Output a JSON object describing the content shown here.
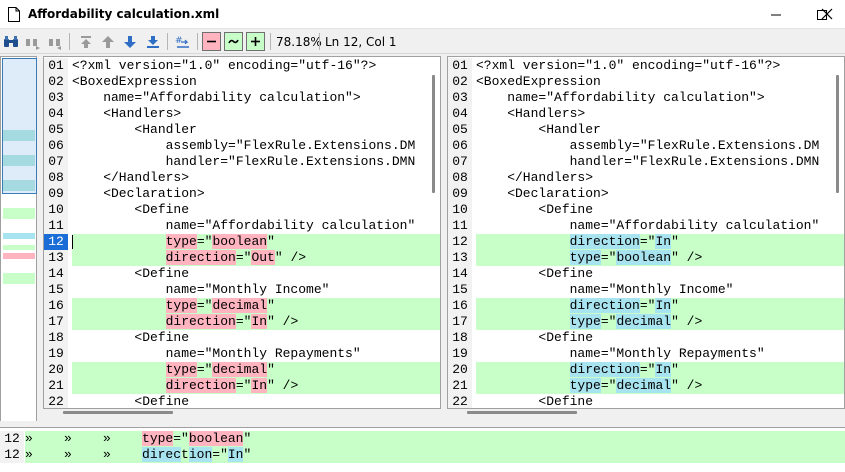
{
  "window": {
    "title": "Affordability calculation.xml"
  },
  "toolbar": {
    "zoom": "78.18%",
    "position": "Ln 12, Col 1"
  },
  "colors": {
    "added": "#c8ffc8",
    "removed": "#ffb4c0",
    "moved": "#a8e4f0",
    "selection": "#1a6dd6"
  },
  "left_pane": {
    "lines": [
      {
        "num": "01",
        "changed": false,
        "parts": [
          {
            "t": "<?xml version=\"1.0\" encoding=\"utf-16\"?>"
          }
        ]
      },
      {
        "num": "02",
        "changed": false,
        "parts": [
          {
            "t": "<BoxedExpression"
          }
        ]
      },
      {
        "num": "03",
        "changed": false,
        "parts": [
          {
            "t": "    name=\"Affordability calculation\">"
          }
        ]
      },
      {
        "num": "04",
        "changed": false,
        "parts": [
          {
            "t": "    <Handlers>"
          }
        ]
      },
      {
        "num": "05",
        "changed": false,
        "parts": [
          {
            "t": "        <Handler"
          }
        ]
      },
      {
        "num": "06",
        "changed": false,
        "parts": [
          {
            "t": "            assembly=\"FlexRule.Extensions.DM"
          }
        ]
      },
      {
        "num": "07",
        "changed": false,
        "parts": [
          {
            "t": "            handler=\"FlexRule.Extensions.DMN"
          }
        ]
      },
      {
        "num": "08",
        "changed": false,
        "parts": [
          {
            "t": "    </Handlers>"
          }
        ]
      },
      {
        "num": "09",
        "changed": false,
        "parts": [
          {
            "t": "    <Declaration>"
          }
        ]
      },
      {
        "num": "10",
        "changed": false,
        "parts": [
          {
            "t": "        <Define"
          }
        ]
      },
      {
        "num": "11",
        "changed": false,
        "parts": [
          {
            "t": "            name=\"Affordability calculation\""
          }
        ]
      },
      {
        "num": "12",
        "changed": true,
        "selected": true,
        "parts": [
          {
            "t": "            "
          },
          {
            "t": "type",
            "h": "red"
          },
          {
            "t": "=\""
          },
          {
            "t": "boolean",
            "h": "red"
          },
          {
            "t": "\""
          }
        ]
      },
      {
        "num": "13",
        "changed": true,
        "parts": [
          {
            "t": "            "
          },
          {
            "t": "direction",
            "h": "red"
          },
          {
            "t": "=\""
          },
          {
            "t": "Out",
            "h": "red"
          },
          {
            "t": "\" />"
          }
        ]
      },
      {
        "num": "14",
        "changed": false,
        "parts": [
          {
            "t": "        <Define"
          }
        ]
      },
      {
        "num": "15",
        "changed": false,
        "parts": [
          {
            "t": "            name=\"Monthly Income\""
          }
        ]
      },
      {
        "num": "16",
        "changed": true,
        "parts": [
          {
            "t": "            "
          },
          {
            "t": "type",
            "h": "red"
          },
          {
            "t": "=\""
          },
          {
            "t": "decimal",
            "h": "red"
          },
          {
            "t": "\""
          }
        ]
      },
      {
        "num": "17",
        "changed": true,
        "parts": [
          {
            "t": "            "
          },
          {
            "t": "direction",
            "h": "red"
          },
          {
            "t": "=\""
          },
          {
            "t": "In",
            "h": "red"
          },
          {
            "t": "\" />"
          }
        ]
      },
      {
        "num": "18",
        "changed": false,
        "parts": [
          {
            "t": "        <Define"
          }
        ]
      },
      {
        "num": "19",
        "changed": false,
        "parts": [
          {
            "t": "            name=\"Monthly Repayments\""
          }
        ]
      },
      {
        "num": "20",
        "changed": true,
        "parts": [
          {
            "t": "            "
          },
          {
            "t": "type",
            "h": "red"
          },
          {
            "t": "=\""
          },
          {
            "t": "decimal",
            "h": "red"
          },
          {
            "t": "\""
          }
        ]
      },
      {
        "num": "21",
        "changed": true,
        "parts": [
          {
            "t": "            "
          },
          {
            "t": "direction",
            "h": "red"
          },
          {
            "t": "=\""
          },
          {
            "t": "In",
            "h": "red"
          },
          {
            "t": "\" />"
          }
        ]
      },
      {
        "num": "22",
        "changed": false,
        "parts": [
          {
            "t": "        <Define"
          }
        ]
      }
    ]
  },
  "right_pane": {
    "lines": [
      {
        "num": "01",
        "changed": false,
        "parts": [
          {
            "t": "<?xml version=\"1.0\" encoding=\"utf-16\"?>"
          }
        ]
      },
      {
        "num": "02",
        "changed": false,
        "parts": [
          {
            "t": "<BoxedExpression"
          }
        ]
      },
      {
        "num": "03",
        "changed": false,
        "parts": [
          {
            "t": "    name=\"Affordability calculation\">"
          }
        ]
      },
      {
        "num": "04",
        "changed": false,
        "parts": [
          {
            "t": "    <Handlers>"
          }
        ]
      },
      {
        "num": "05",
        "changed": false,
        "parts": [
          {
            "t": "        <Handler"
          }
        ]
      },
      {
        "num": "06",
        "changed": false,
        "parts": [
          {
            "t": "            assembly=\"FlexRule.Extensions.DM"
          }
        ]
      },
      {
        "num": "07",
        "changed": false,
        "parts": [
          {
            "t": "            handler=\"FlexRule.Extensions.DMN"
          }
        ]
      },
      {
        "num": "08",
        "changed": false,
        "parts": [
          {
            "t": "    </Handlers>"
          }
        ]
      },
      {
        "num": "09",
        "changed": false,
        "parts": [
          {
            "t": "    <Declaration>"
          }
        ]
      },
      {
        "num": "10",
        "changed": false,
        "parts": [
          {
            "t": "        <Define"
          }
        ]
      },
      {
        "num": "11",
        "changed": false,
        "parts": [
          {
            "t": "            name=\"Affordability calculation\""
          }
        ]
      },
      {
        "num": "12",
        "changed": true,
        "parts": [
          {
            "t": "            "
          },
          {
            "t": "direction",
            "h": "blue"
          },
          {
            "t": "=\""
          },
          {
            "t": "In",
            "h": "blue"
          },
          {
            "t": "\""
          }
        ]
      },
      {
        "num": "13",
        "changed": true,
        "parts": [
          {
            "t": "            "
          },
          {
            "t": "type",
            "h": "blue"
          },
          {
            "t": "=\""
          },
          {
            "t": "boolean",
            "h": "blue"
          },
          {
            "t": "\" />"
          }
        ]
      },
      {
        "num": "14",
        "changed": false,
        "parts": [
          {
            "t": "        <Define"
          }
        ]
      },
      {
        "num": "15",
        "changed": false,
        "parts": [
          {
            "t": "            name=\"Monthly Income\""
          }
        ]
      },
      {
        "num": "16",
        "changed": true,
        "parts": [
          {
            "t": "            "
          },
          {
            "t": "direction",
            "h": "blue"
          },
          {
            "t": "=\""
          },
          {
            "t": "In",
            "h": "blue"
          },
          {
            "t": "\""
          }
        ]
      },
      {
        "num": "17",
        "changed": true,
        "parts": [
          {
            "t": "            "
          },
          {
            "t": "type",
            "h": "blue"
          },
          {
            "t": "=\""
          },
          {
            "t": "decimal",
            "h": "blue"
          },
          {
            "t": "\" />"
          }
        ]
      },
      {
        "num": "18",
        "changed": false,
        "parts": [
          {
            "t": "        <Define"
          }
        ]
      },
      {
        "num": "19",
        "changed": false,
        "parts": [
          {
            "t": "            name=\"Monthly Repayments\""
          }
        ]
      },
      {
        "num": "20",
        "changed": true,
        "parts": [
          {
            "t": "            "
          },
          {
            "t": "direction",
            "h": "blue"
          },
          {
            "t": "=\""
          },
          {
            "t": "In",
            "h": "blue"
          },
          {
            "t": "\""
          }
        ]
      },
      {
        "num": "21",
        "changed": true,
        "parts": [
          {
            "t": "            "
          },
          {
            "t": "type",
            "h": "blue"
          },
          {
            "t": "=\""
          },
          {
            "t": "decimal",
            "h": "blue"
          },
          {
            "t": "\" />"
          }
        ]
      },
      {
        "num": "22",
        "changed": false,
        "parts": [
          {
            "t": "        <Define"
          }
        ]
      }
    ]
  },
  "detail": {
    "lines": [
      {
        "num": "12",
        "parts": [
          {
            "t": "»    »    »    "
          },
          {
            "t": "type",
            "h": "red"
          },
          {
            "t": "=\""
          },
          {
            "t": "boolean",
            "h": "red"
          },
          {
            "t": "\""
          }
        ]
      },
      {
        "num": "12",
        "parts": [
          {
            "t": "»    »    »    "
          },
          {
            "t": "direc",
            "h": "blue"
          },
          {
            "t": "t"
          },
          {
            "t": "ion",
            "h": "blue"
          },
          {
            "t": "=\""
          },
          {
            "t": "In",
            "h": "blue"
          },
          {
            "t": "\""
          }
        ]
      }
    ]
  }
}
